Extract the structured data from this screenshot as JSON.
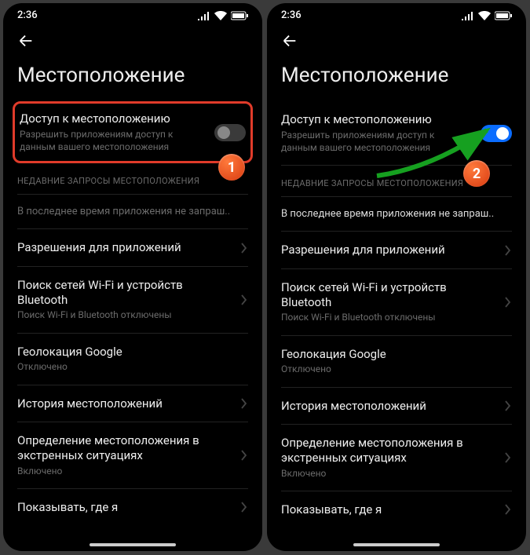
{
  "status": {
    "time": "2:36"
  },
  "page_title": "Местоположение",
  "access": {
    "title": "Доступ к местоположению",
    "sub": "Разрешить приложениям доступ к данным вашего местоположения"
  },
  "section_header": "НЕДАВНИЕ ЗАПРОСЫ МЕСТОПОЛОЖЕНИЯ",
  "recent_text": "В последнее время приложения не запраш..",
  "items": {
    "perms": {
      "title": "Разрешения для приложений"
    },
    "wifi": {
      "title": "Поиск сетей Wi-Fi и устройств Bluetooth",
      "sub": "Поиск Wi-Fi и Bluetooth отключены"
    },
    "google_geo": {
      "title": "Геолокация Google",
      "sub": "Отключено"
    },
    "history": {
      "title": "История местоположений"
    },
    "emergency": {
      "title": "Определение местоположения в экстренных ситуациях",
      "sub": "Включено"
    },
    "show_where": {
      "title": "Показывать, где я"
    }
  },
  "badges": {
    "one": "1",
    "two": "2"
  }
}
